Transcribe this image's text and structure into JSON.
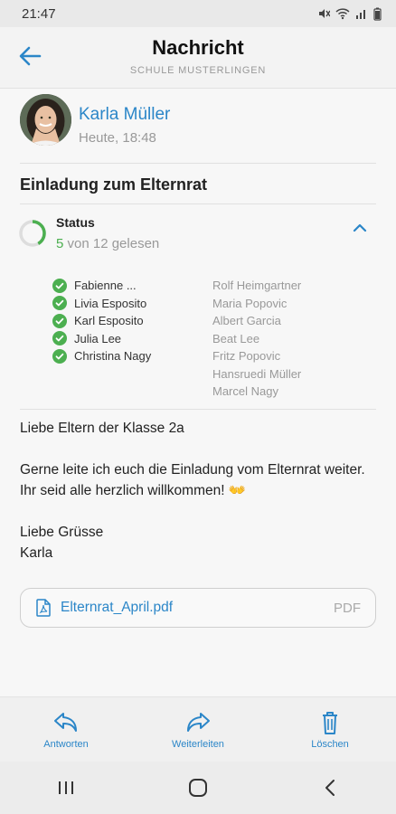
{
  "status_bar": {
    "time": "21:47"
  },
  "header": {
    "title": "Nachricht",
    "subtitle": "SCHULE MUSTERLINGEN"
  },
  "message": {
    "sender_name": "Karla Müller",
    "sent_time": "Heute, 18:48",
    "subject": "Einladung zum Elternrat",
    "read_status": {
      "label": "Status",
      "read_count": "5",
      "count_text": "von 12 gelesen",
      "read_fraction": 0.4167,
      "read_by": [
        "Fabienne ...",
        "Livia Esposito",
        "Karl Esposito",
        "Julia Lee",
        "Christina Nagy"
      ],
      "not_read_by": [
        "Rolf Heimgartner",
        "Maria Popovic",
        "Albert Garcia",
        "Beat Lee",
        "Fritz Popovic",
        "Hansruedi Müller",
        "Marcel Nagy"
      ]
    },
    "body": {
      "greeting": "Liebe Eltern der Klasse 2a",
      "paragraph": "Gerne leite ich euch die Einladung vom Elternrat weiter. Ihr seid alle herzlich willkommen! 👐",
      "closing_line1": "Liebe Grüsse",
      "closing_line2": "Karla"
    },
    "attachment": {
      "file_name": "Elternrat_April.pdf",
      "file_type": "PDF"
    }
  },
  "actions": {
    "reply_label": "Antworten",
    "forward_label": "Weiterleiten",
    "delete_label": "Löschen"
  },
  "colors": {
    "accent": "#2b86c8",
    "read_green": "#4caf50",
    "muted": "#999999"
  },
  "icons": {
    "back": "arrow-left-icon",
    "expand": "chevron-up-icon",
    "check": "check-circle-icon",
    "pdf": "pdf-file-icon",
    "reply": "reply-arrow-icon",
    "forward": "forward-arrow-icon",
    "delete": "trash-icon",
    "nav_recent": "recent-apps-icon",
    "nav_home": "home-icon",
    "nav_back": "nav-back-icon"
  }
}
